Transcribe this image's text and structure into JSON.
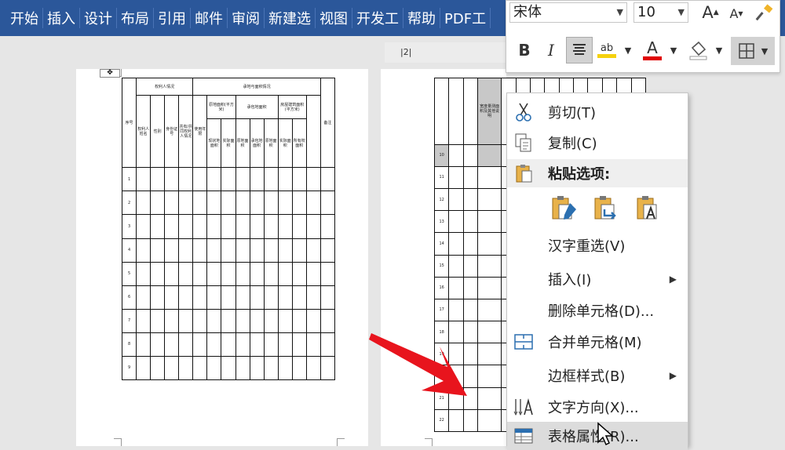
{
  "ribbon_tabs": [
    "开始",
    "插入",
    "设计",
    "布局",
    "引用",
    "邮件",
    "审阅",
    "新建选",
    "视图",
    "开发工",
    "帮助",
    "PDF工"
  ],
  "ruler_text": "|2|",
  "page1_table": {
    "group_headers": [
      "权利人情况",
      "承地与面积情况"
    ],
    "col_headers": [
      "序号",
      "权利人姓名",
      "性别",
      "身份证号",
      "共有/共同权利人情况",
      "使用年限",
      "原地面积(平方米)",
      "现状地面积",
      "实际面积",
      "原地面积",
      "承包地面积",
      "房屋建筑面积(平方米)",
      "实际面积",
      "所有权面积",
      "备注"
    ],
    "row_numbers": [
      "1",
      "2",
      "3",
      "4",
      "5",
      "6",
      "7",
      "8",
      "9"
    ]
  },
  "page2_table": {
    "header_text": "宽度量测面积及其他说明",
    "row_numbers": [
      "10",
      "11",
      "12",
      "13",
      "14",
      "15",
      "16",
      "17",
      "18",
      "19",
      "20",
      "21",
      "22"
    ]
  },
  "mini_toolbar": {
    "font_name": "宋体",
    "font_size": "10",
    "grow_font": "A",
    "shrink_font": "A",
    "bold": "B",
    "italic": "I",
    "highlight_text": "ab",
    "font_color_text": "A",
    "highlight_color": "#f5d10d",
    "font_color": "#e00000"
  },
  "context_menu": {
    "items": [
      {
        "label": "剪切(T)",
        "icon": "scissors-icon"
      },
      {
        "label": "复制(C)",
        "icon": "copy-icon"
      },
      {
        "label": "粘贴选项:",
        "icon": "clipboard-icon"
      },
      {
        "label": "汉字重选(V)",
        "icon": ""
      },
      {
        "label": "插入(I)",
        "icon": ""
      },
      {
        "label": "删除单元格(D)...",
        "icon": ""
      },
      {
        "label": "合并单元格(M)",
        "icon": "merge-cells-icon"
      },
      {
        "label": "边框样式(B)",
        "icon": ""
      },
      {
        "label": "文字方向(X)...",
        "icon": "text-direction-icon"
      },
      {
        "label": "表格属性(R)...",
        "icon": "table-properties-icon"
      }
    ]
  },
  "colors": {
    "ribbon": "#2b579a",
    "arrow": "#e8141d",
    "menu_highlight": "#dcdcdc"
  }
}
